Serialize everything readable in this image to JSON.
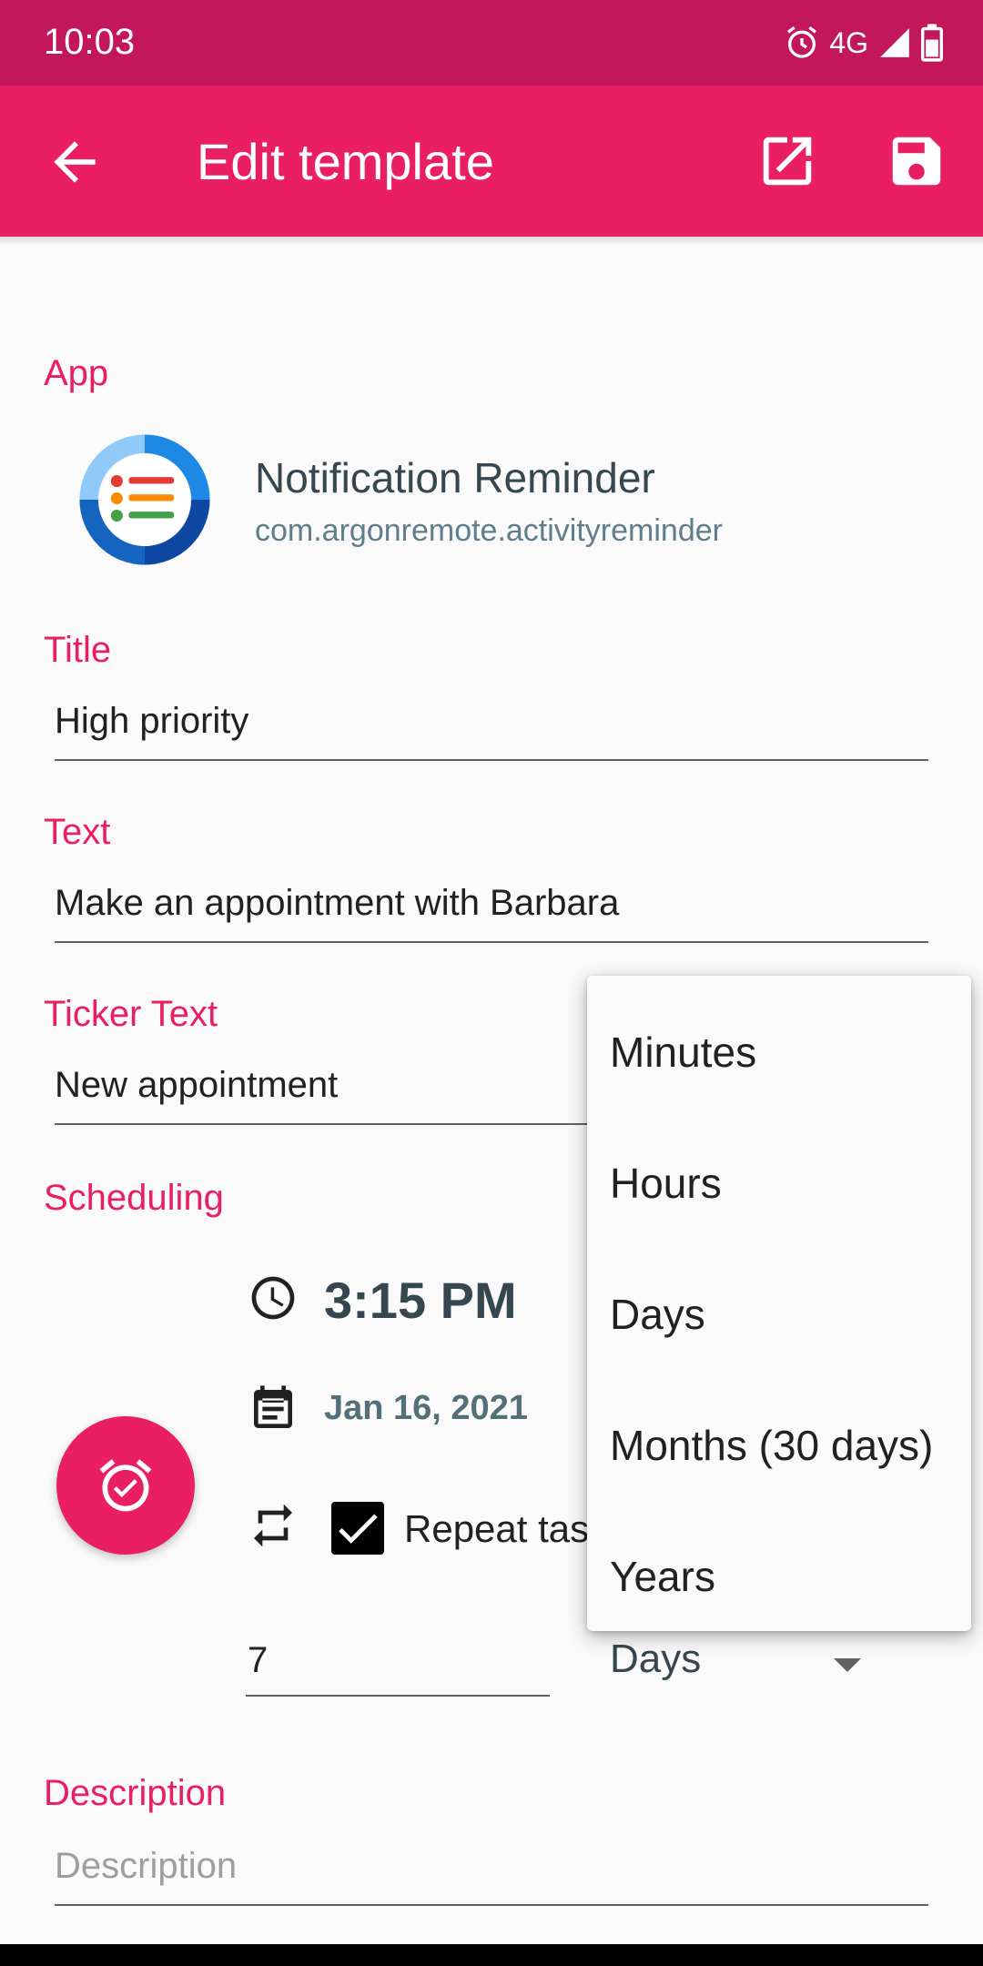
{
  "status_bar": {
    "time": "10:03",
    "network": "4G",
    "icons": [
      "alarm-icon",
      "signal-icon",
      "battery-icon"
    ]
  },
  "app_bar": {
    "title": "Edit template",
    "icons": [
      "arrow-back-icon",
      "open-in-new-icon",
      "save-icon"
    ]
  },
  "app_section": {
    "label": "App",
    "app_name": "Notification Reminder",
    "package_name": "com.argonremote.activityreminder"
  },
  "title_section": {
    "label": "Title",
    "value": "High priority"
  },
  "text_section": {
    "label": "Text",
    "value": "Make an appointment with Barbara"
  },
  "ticker_section": {
    "label": "Ticker Text",
    "value": "New appointment"
  },
  "scheduling": {
    "label": "Scheduling",
    "time": "3:15 PM",
    "date": "Jan 16, 2021",
    "repeat_label": "Repeat tas",
    "repeat_checked": true,
    "interval_value": "7",
    "interval_unit": "Days"
  },
  "dropdown": {
    "options": [
      "Minutes",
      "Hours",
      "Days",
      "Months (30 days)",
      "Years"
    ]
  },
  "description_section": {
    "label": "Description",
    "placeholder": "Description"
  },
  "colors": {
    "status_bar": "#c2185b",
    "primary": "#e91e63",
    "background": "#fafafa"
  }
}
